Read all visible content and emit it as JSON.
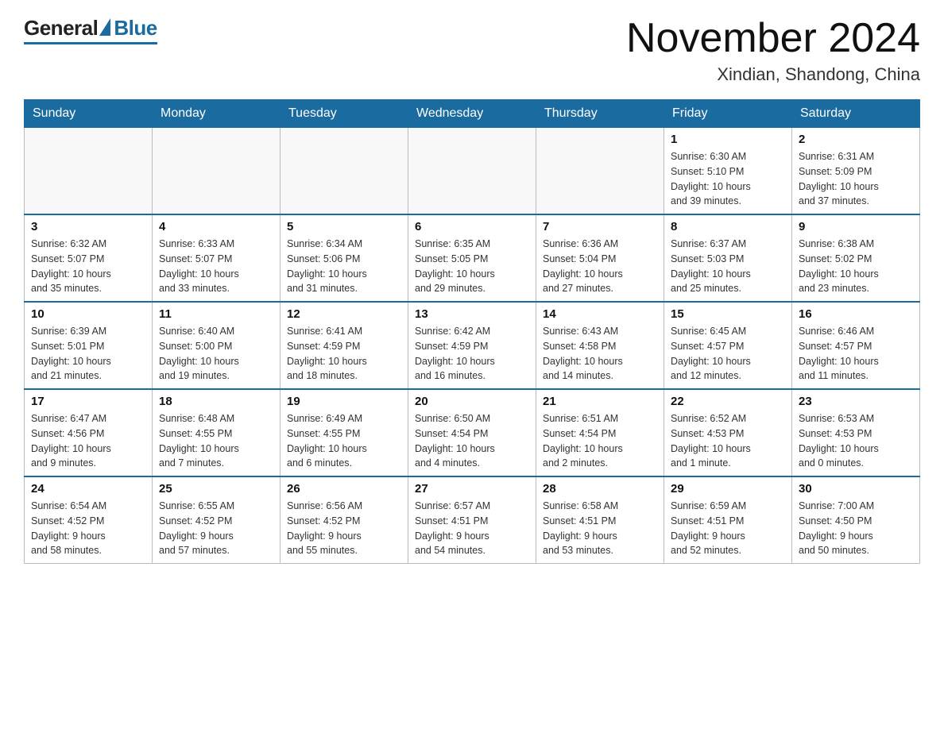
{
  "header": {
    "logo": {
      "general": "General",
      "blue": "Blue"
    },
    "title": "November 2024",
    "location": "Xindian, Shandong, China"
  },
  "weekdays": [
    "Sunday",
    "Monday",
    "Tuesday",
    "Wednesday",
    "Thursday",
    "Friday",
    "Saturday"
  ],
  "weeks": [
    [
      {
        "day": "",
        "info": ""
      },
      {
        "day": "",
        "info": ""
      },
      {
        "day": "",
        "info": ""
      },
      {
        "day": "",
        "info": ""
      },
      {
        "day": "",
        "info": ""
      },
      {
        "day": "1",
        "info": "Sunrise: 6:30 AM\nSunset: 5:10 PM\nDaylight: 10 hours\nand 39 minutes."
      },
      {
        "day": "2",
        "info": "Sunrise: 6:31 AM\nSunset: 5:09 PM\nDaylight: 10 hours\nand 37 minutes."
      }
    ],
    [
      {
        "day": "3",
        "info": "Sunrise: 6:32 AM\nSunset: 5:07 PM\nDaylight: 10 hours\nand 35 minutes."
      },
      {
        "day": "4",
        "info": "Sunrise: 6:33 AM\nSunset: 5:07 PM\nDaylight: 10 hours\nand 33 minutes."
      },
      {
        "day": "5",
        "info": "Sunrise: 6:34 AM\nSunset: 5:06 PM\nDaylight: 10 hours\nand 31 minutes."
      },
      {
        "day": "6",
        "info": "Sunrise: 6:35 AM\nSunset: 5:05 PM\nDaylight: 10 hours\nand 29 minutes."
      },
      {
        "day": "7",
        "info": "Sunrise: 6:36 AM\nSunset: 5:04 PM\nDaylight: 10 hours\nand 27 minutes."
      },
      {
        "day": "8",
        "info": "Sunrise: 6:37 AM\nSunset: 5:03 PM\nDaylight: 10 hours\nand 25 minutes."
      },
      {
        "day": "9",
        "info": "Sunrise: 6:38 AM\nSunset: 5:02 PM\nDaylight: 10 hours\nand 23 minutes."
      }
    ],
    [
      {
        "day": "10",
        "info": "Sunrise: 6:39 AM\nSunset: 5:01 PM\nDaylight: 10 hours\nand 21 minutes."
      },
      {
        "day": "11",
        "info": "Sunrise: 6:40 AM\nSunset: 5:00 PM\nDaylight: 10 hours\nand 19 minutes."
      },
      {
        "day": "12",
        "info": "Sunrise: 6:41 AM\nSunset: 4:59 PM\nDaylight: 10 hours\nand 18 minutes."
      },
      {
        "day": "13",
        "info": "Sunrise: 6:42 AM\nSunset: 4:59 PM\nDaylight: 10 hours\nand 16 minutes."
      },
      {
        "day": "14",
        "info": "Sunrise: 6:43 AM\nSunset: 4:58 PM\nDaylight: 10 hours\nand 14 minutes."
      },
      {
        "day": "15",
        "info": "Sunrise: 6:45 AM\nSunset: 4:57 PM\nDaylight: 10 hours\nand 12 minutes."
      },
      {
        "day": "16",
        "info": "Sunrise: 6:46 AM\nSunset: 4:57 PM\nDaylight: 10 hours\nand 11 minutes."
      }
    ],
    [
      {
        "day": "17",
        "info": "Sunrise: 6:47 AM\nSunset: 4:56 PM\nDaylight: 10 hours\nand 9 minutes."
      },
      {
        "day": "18",
        "info": "Sunrise: 6:48 AM\nSunset: 4:55 PM\nDaylight: 10 hours\nand 7 minutes."
      },
      {
        "day": "19",
        "info": "Sunrise: 6:49 AM\nSunset: 4:55 PM\nDaylight: 10 hours\nand 6 minutes."
      },
      {
        "day": "20",
        "info": "Sunrise: 6:50 AM\nSunset: 4:54 PM\nDaylight: 10 hours\nand 4 minutes."
      },
      {
        "day": "21",
        "info": "Sunrise: 6:51 AM\nSunset: 4:54 PM\nDaylight: 10 hours\nand 2 minutes."
      },
      {
        "day": "22",
        "info": "Sunrise: 6:52 AM\nSunset: 4:53 PM\nDaylight: 10 hours\nand 1 minute."
      },
      {
        "day": "23",
        "info": "Sunrise: 6:53 AM\nSunset: 4:53 PM\nDaylight: 10 hours\nand 0 minutes."
      }
    ],
    [
      {
        "day": "24",
        "info": "Sunrise: 6:54 AM\nSunset: 4:52 PM\nDaylight: 9 hours\nand 58 minutes."
      },
      {
        "day": "25",
        "info": "Sunrise: 6:55 AM\nSunset: 4:52 PM\nDaylight: 9 hours\nand 57 minutes."
      },
      {
        "day": "26",
        "info": "Sunrise: 6:56 AM\nSunset: 4:52 PM\nDaylight: 9 hours\nand 55 minutes."
      },
      {
        "day": "27",
        "info": "Sunrise: 6:57 AM\nSunset: 4:51 PM\nDaylight: 9 hours\nand 54 minutes."
      },
      {
        "day": "28",
        "info": "Sunrise: 6:58 AM\nSunset: 4:51 PM\nDaylight: 9 hours\nand 53 minutes."
      },
      {
        "day": "29",
        "info": "Sunrise: 6:59 AM\nSunset: 4:51 PM\nDaylight: 9 hours\nand 52 minutes."
      },
      {
        "day": "30",
        "info": "Sunrise: 7:00 AM\nSunset: 4:50 PM\nDaylight: 9 hours\nand 50 minutes."
      }
    ]
  ]
}
